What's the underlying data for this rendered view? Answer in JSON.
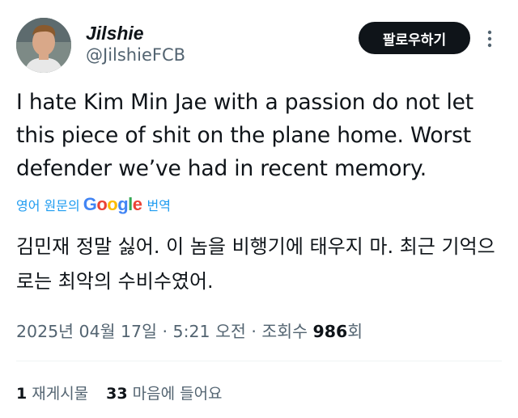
{
  "author": {
    "name": "Jilshie",
    "handle": "@JilshieFCB"
  },
  "actions": {
    "follow_label": "팔로우하기",
    "more_icon": "more-vertical-icon"
  },
  "tweet": {
    "text": "I hate Kim Min Jae with a passion do not let this piece of shit on the plane home. Worst defender we’ve had in recent memory."
  },
  "translation": {
    "source_label": "영어 원문의",
    "provider": "Google",
    "action_label": "번역",
    "text": "김민재 정말 싫어. 이 놈을 비행기에 태우지 마. 최근 기억으로는 최악의 수비수였어."
  },
  "meta": {
    "date": "2025년 04월 17일",
    "time": "5:21 오전",
    "views_label": "조회수",
    "views_count": "986",
    "views_suffix": "회"
  },
  "stats": {
    "reposts_count": "1",
    "reposts_label": "재게시물",
    "likes_count": "33",
    "likes_label": "마음에 들어요"
  },
  "colors": {
    "text": "#0f1419",
    "secondary": "#536471",
    "link": "#1d9bf0",
    "button_bg": "#0f1419"
  }
}
